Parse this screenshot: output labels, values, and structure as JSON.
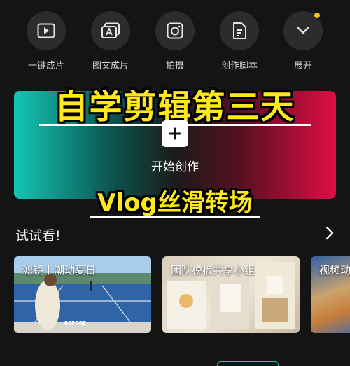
{
  "actions": [
    {
      "label": "一键成片",
      "icon": "play-box-icon"
    },
    {
      "label": "图文成片",
      "icon": "stacked-text-icon"
    },
    {
      "label": "拍摄",
      "icon": "camera-icon"
    },
    {
      "label": "创作脚本",
      "icon": "script-document-icon"
    },
    {
      "label": "展开",
      "icon": "chevron-down-icon"
    }
  ],
  "banner": {
    "overlay_title": "自学剪辑第三天",
    "start_label": "开始创作",
    "overlay_subtitle": "Vlog丝滑转场"
  },
  "try": {
    "title": "试试看!",
    "cards": [
      {
        "title": "滤镜丨潮动夏日",
        "tag": "BEFORE"
      },
      {
        "title": "团队模板共享小组"
      },
      {
        "title": "视频动"
      }
    ]
  },
  "colors": {
    "background": "#141414",
    "accent_yellow": "#ffe81a",
    "teal": "#13c6b6",
    "red": "#e10d45",
    "notification_dot": "#f5c518"
  }
}
